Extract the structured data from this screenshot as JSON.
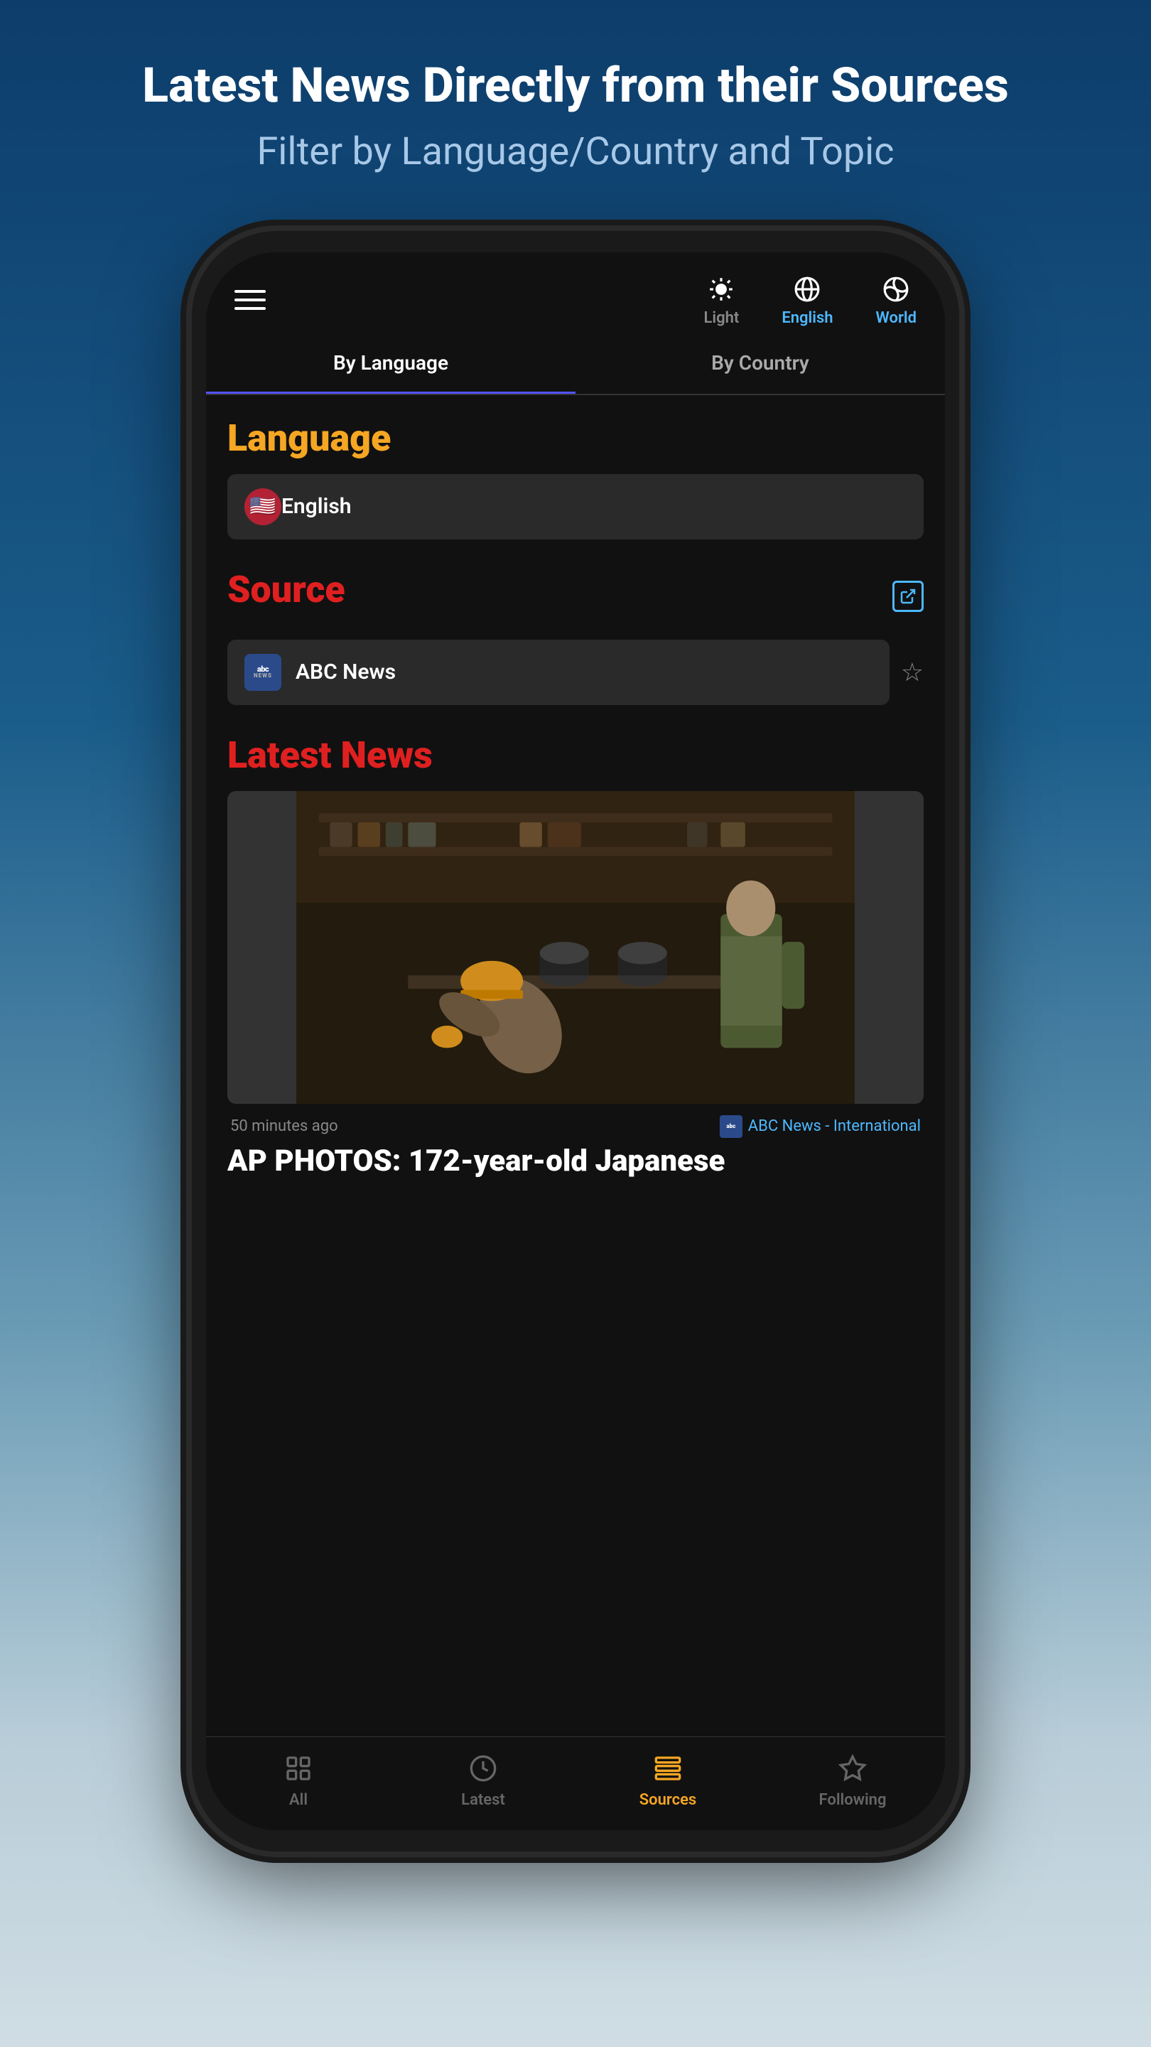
{
  "promo": {
    "title": "Latest News Directly from their Sources",
    "subtitle": "Filter by Language/Country and Topic"
  },
  "header": {
    "nav_items": [
      {
        "icon": "brightness",
        "label": "Light",
        "active": false
      },
      {
        "icon": "globe",
        "label": "English",
        "active": true
      },
      {
        "icon": "world",
        "label": "World",
        "active": false
      }
    ]
  },
  "tabs": {
    "by_language": "By Language",
    "by_country": "By Country"
  },
  "language_section": {
    "title": "Language",
    "selected": "English",
    "flag_emoji": "🇺🇸"
  },
  "source_section": {
    "title": "Source",
    "selected": "ABC News",
    "external_link_label": "external link"
  },
  "latest_news": {
    "title": "Latest News",
    "timestamp": "50 minutes ago",
    "source_name": "ABC News - International",
    "headline": "AP PHOTOS: 172-year-old Japanese"
  },
  "bottom_nav": {
    "items": [
      {
        "label": "All",
        "active": false
      },
      {
        "label": "Latest",
        "active": false
      },
      {
        "label": "Sources",
        "active": true
      },
      {
        "label": "Following",
        "active": false
      }
    ]
  }
}
